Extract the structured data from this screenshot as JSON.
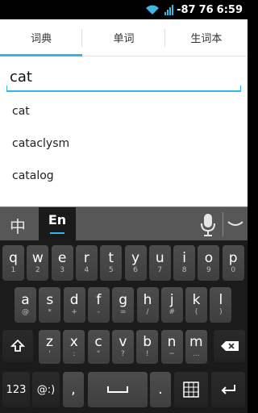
{
  "status": {
    "signal": "-87",
    "battery": "76",
    "time": "6:59"
  },
  "tabs": [
    {
      "label": "词典"
    },
    {
      "label": "单词"
    },
    {
      "label": "生词本"
    }
  ],
  "search": {
    "value": "cat"
  },
  "results": [
    "cat",
    "cataclysm",
    "catalog"
  ],
  "ime": {
    "cn_label": "中",
    "en_label": "En"
  },
  "keyboard": {
    "row1": [
      {
        "k": "q",
        "s": "1"
      },
      {
        "k": "w",
        "s": "2"
      },
      {
        "k": "e",
        "s": "3"
      },
      {
        "k": "r",
        "s": "4"
      },
      {
        "k": "t",
        "s": "5"
      },
      {
        "k": "y",
        "s": "6"
      },
      {
        "k": "u",
        "s": "7"
      },
      {
        "k": "i",
        "s": "8"
      },
      {
        "k": "o",
        "s": "9"
      },
      {
        "k": "p",
        "s": "0"
      }
    ],
    "row2": [
      {
        "k": "a",
        "s": "@"
      },
      {
        "k": "s",
        "s": "*"
      },
      {
        "k": "d",
        "s": "+"
      },
      {
        "k": "f",
        "s": "-"
      },
      {
        "k": "g",
        "s": "="
      },
      {
        "k": "h",
        "s": "/"
      },
      {
        "k": "j",
        "s": "#"
      },
      {
        "k": "k",
        "s": "("
      },
      {
        "k": "l",
        "s": ")"
      }
    ],
    "row3": [
      {
        "k": "z",
        "s": "'"
      },
      {
        "k": "x",
        "s": ":"
      },
      {
        "k": "c",
        "s": "\""
      },
      {
        "k": "v",
        "s": "?"
      },
      {
        "k": "b",
        "s": "!"
      },
      {
        "k": "n",
        "s": "~"
      },
      {
        "k": "m",
        "s": "..."
      }
    ],
    "num_label": "123",
    "emoticon_label": "@:)",
    "comma_label": ",",
    "period_label": "."
  }
}
